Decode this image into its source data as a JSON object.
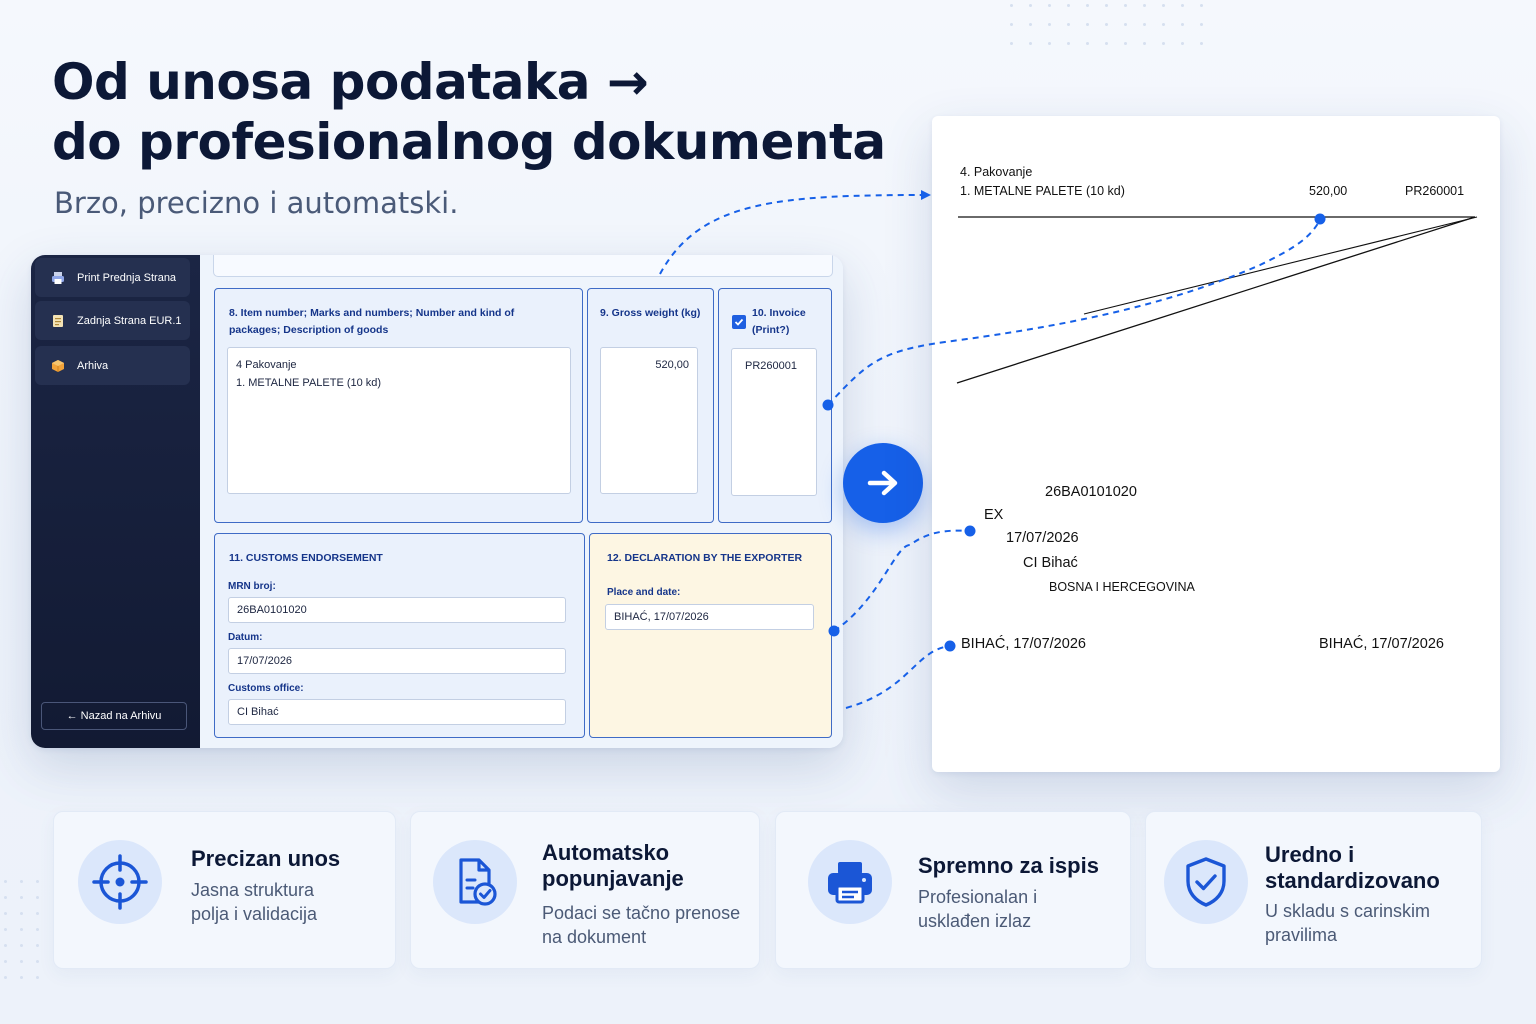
{
  "hero": {
    "title_line1": "Od unosa podataka →",
    "title_line2": "do profesionalnog dokumenta",
    "subtitle": "Brzo, precizno i automatski."
  },
  "sidebar": {
    "items": [
      {
        "label": "Print Prednja Strana",
        "icon": "printer-icon"
      },
      {
        "label": "Zadnja Strana EUR.1",
        "icon": "document-icon"
      },
      {
        "label": "Arhiva",
        "icon": "box-icon"
      }
    ],
    "back_label": "← Nazad na Arhivu"
  },
  "form": {
    "box8": {
      "label": "8. Item number; Marks and numbers; Number and kind of packages; Description of goods",
      "value": "4 Pakovanje\n1. METALNE PALETE (10 kd)"
    },
    "box9": {
      "label": "9. Gross weight (kg)",
      "value": "520,00"
    },
    "box10": {
      "label": "10. Invoice (Print?)",
      "value": "PR260001",
      "checked": true
    },
    "box11": {
      "label": "11. CUSTOMS ENDORSEMENT",
      "mrn_label": "MRN broj:",
      "mrn_value": "26BA0101020",
      "date_label": "Datum:",
      "date_value": "17/07/2026",
      "office_label": "Customs office:",
      "office_value": "CI Bihać"
    },
    "box12": {
      "label": "12. DECLARATION BY THE EXPORTER",
      "place_label": "Place and date:",
      "place_value": "BIHAĆ, 17/07/2026"
    }
  },
  "document": {
    "packaging": "4. Pakovanje",
    "goods": "1. METALNE PALETE (10 kd)",
    "weight": "520,00",
    "invoice": "PR260001",
    "mrn": "26BA0101020",
    "ex": "EX",
    "date": "17/07/2026",
    "office": "CI Bihać",
    "country": "BOSNA I HERCEGOVINA",
    "place_left": "BIHAĆ, 17/07/2026",
    "place_right": "BIHAĆ, 17/07/2026"
  },
  "cards": [
    {
      "title": "Precizan unos",
      "desc": "Jasna struktura polja i validacija",
      "icon": "crosshair-icon"
    },
    {
      "title": "Automatsko popunjavanje",
      "desc": "Podaci se tačno prenose na dokument",
      "icon": "document-check-icon"
    },
    {
      "title": "Spremno za ispis",
      "desc": "Profesionalan i usklađen izlaz",
      "icon": "printer-icon"
    },
    {
      "title": "Uredno i standardizovano",
      "desc": "U skladu s carinskim pravilima",
      "icon": "shield-check-icon"
    }
  ],
  "colors": {
    "accent": "#1660e8",
    "navy": "#0c1836",
    "sidebar_bg": "#1b2544",
    "form_border": "#3f6bc6",
    "box12_bg": "#fdf6e3"
  }
}
